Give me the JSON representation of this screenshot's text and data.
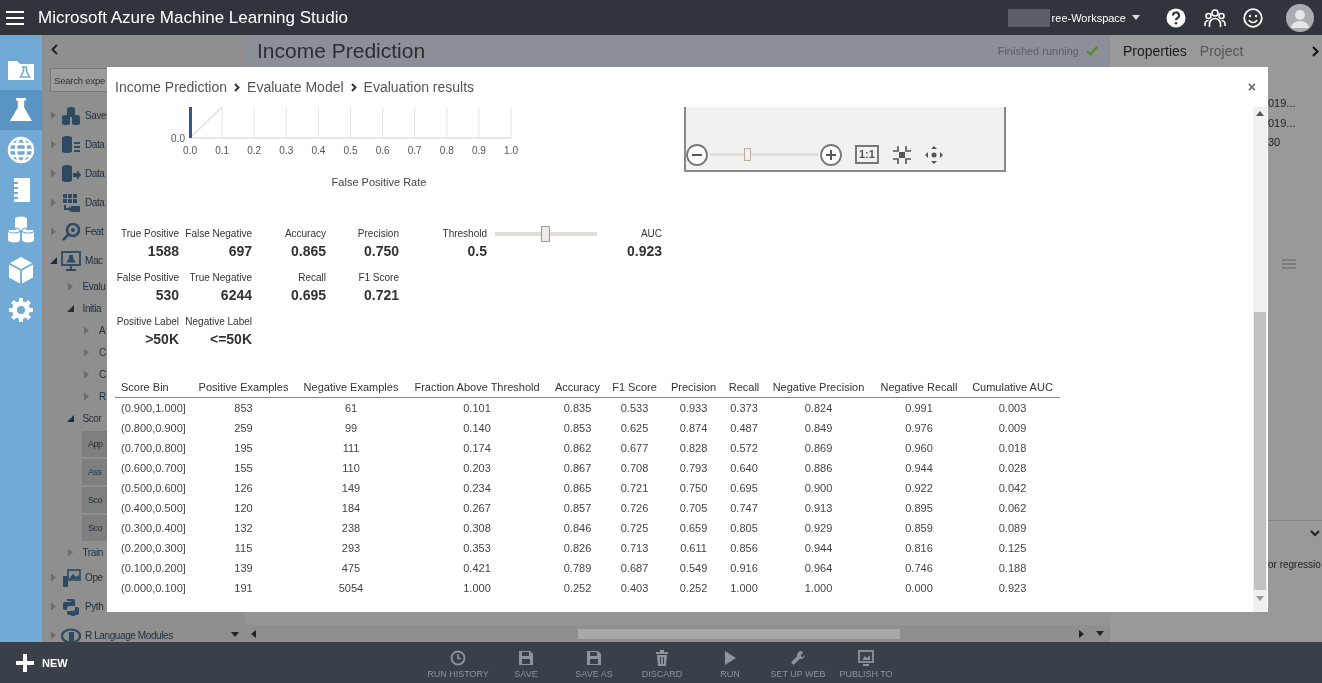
{
  "top_bar": {
    "title": "Microsoft Azure Machine Learning Studio",
    "workspace": "ree-Workspace"
  },
  "nav_rail": [
    {
      "kind": "experiments-folder",
      "selected": false
    },
    {
      "kind": "experiments",
      "selected": true
    },
    {
      "kind": "web-services",
      "selected": false
    },
    {
      "kind": "notebooks",
      "selected": false
    },
    {
      "kind": "datasets",
      "selected": false
    },
    {
      "kind": "trained-models",
      "selected": false
    },
    {
      "kind": "settings",
      "selected": false
    }
  ],
  "palette": {
    "search": {
      "placeholder": "Search expe"
    },
    "items": [
      {
        "label": "Save",
        "kind": "datasets",
        "expanded": false
      },
      {
        "label": "Data",
        "kind": "data-format",
        "expanded": false
      },
      {
        "label": "Data",
        "kind": "data-io",
        "expanded": false
      },
      {
        "label": "Data",
        "kind": "data-transform",
        "expanded": false
      },
      {
        "label": "Feat",
        "kind": "feature-selection",
        "expanded": false
      },
      {
        "label": "Mac",
        "kind": "ml",
        "expanded": true,
        "children": [
          {
            "label": "Evalu",
            "expanded": false
          },
          {
            "label": "Initia",
            "expanded": true,
            "children": [
              {
                "label": "A",
                "expanded": false
              },
              {
                "label": "C",
                "expanded": false
              },
              {
                "label": "C",
                "expanded": false
              },
              {
                "label": "R",
                "expanded": false
              }
            ]
          },
          {
            "label": "Scor",
            "expanded": true,
            "children": [
              {
                "label": "App",
                "kind": "module"
              },
              {
                "label": "Ass",
                "kind": "module"
              },
              {
                "label": "Sco",
                "kind": "module"
              },
              {
                "label": "Sco",
                "kind": "module"
              }
            ]
          },
          {
            "label": "Train",
            "expanded": false
          }
        ]
      },
      {
        "label": "Ope",
        "kind": "opencv",
        "expanded": false
      },
      {
        "label": "Pyth",
        "kind": "python",
        "expanded": false
      },
      {
        "label": "R Language Modules",
        "kind": "r",
        "expanded": false
      }
    ]
  },
  "canvas": {
    "title": "Income Prediction",
    "status": "Finished running"
  },
  "properties_panel": {
    "tabs": [
      {
        "label": "Properties",
        "selected": true
      },
      {
        "label": "Project",
        "selected": false
      }
    ],
    "values": [
      "019...",
      "019...",
      "30"
    ],
    "description": "or regressio"
  },
  "bottom_bar": {
    "new_label": "NEW",
    "actions": [
      {
        "kind": "history",
        "label": "RUN HISTORY"
      },
      {
        "kind": "save",
        "label": "SAVE"
      },
      {
        "kind": "save-as",
        "label": "SAVE AS"
      },
      {
        "kind": "discard",
        "label": "DISCARD"
      },
      {
        "kind": "run",
        "label": "RUN"
      },
      {
        "kind": "web-service",
        "label": "SET UP WEB"
      },
      {
        "kind": "publish",
        "label": "PUBLISH TO"
      }
    ]
  },
  "dialog": {
    "breadcrumb": [
      "Income Prediction",
      "Evaluate Model",
      "Evaluation results"
    ],
    "close": "×",
    "roc_chart": {
      "y_tick_labels": [
        "0.0"
      ],
      "x_tick_labels": [
        "0.0",
        "0.1",
        "0.2",
        "0.3",
        "0.4",
        "0.5",
        "0.6",
        "0.7",
        "0.8",
        "0.9",
        "1.0"
      ],
      "xlabel": "False Positive Rate"
    },
    "zoom_controls": {
      "level": 0.35,
      "actual_size": "1:1"
    },
    "metrics": {
      "rows": [
        [
          {
            "label": "True Positive",
            "value": "1588"
          },
          {
            "label": "False Negative",
            "value": "697"
          },
          {
            "label": "Accuracy",
            "value": "0.865"
          },
          {
            "label": "Precision",
            "value": "0.750"
          }
        ],
        [
          {
            "label": "False Positive",
            "value": "530"
          },
          {
            "label": "True Negative",
            "value": "6244"
          },
          {
            "label": "Recall",
            "value": "0.695"
          },
          {
            "label": "F1 Score",
            "value": "0.721"
          }
        ],
        [
          {
            "label": "Positive Label",
            "value": ">50K"
          },
          {
            "label": "Negative Label",
            "value": "<=50K"
          }
        ]
      ],
      "threshold": {
        "label": "Threshold",
        "value": "0.5",
        "level": 0.5
      },
      "auc": {
        "label": "AUC",
        "value": "0.923"
      }
    },
    "table": {
      "columns": [
        "Score Bin",
        "Positive Examples",
        "Negative Examples",
        "Fraction Above Threshold",
        "Accuracy",
        "F1 Score",
        "Precision",
        "Recall",
        "Negative Precision",
        "Negative Recall",
        "Cumulative AUC"
      ],
      "rows": [
        [
          "(0.900,1.000]",
          "853",
          "61",
          "0.101",
          "0.835",
          "0.533",
          "0.933",
          "0.373",
          "0.824",
          "0.991",
          "0.003"
        ],
        [
          "(0.800,0.900]",
          "259",
          "99",
          "0.140",
          "0.853",
          "0.625",
          "0.874",
          "0.487",
          "0.849",
          "0.976",
          "0.009"
        ],
        [
          "(0.700,0.800]",
          "195",
          "111",
          "0.174",
          "0.862",
          "0.677",
          "0.828",
          "0.572",
          "0.869",
          "0.960",
          "0.018"
        ],
        [
          "(0.600,0.700]",
          "155",
          "110",
          "0.203",
          "0.867",
          "0.708",
          "0.793",
          "0.640",
          "0.886",
          "0.944",
          "0.028"
        ],
        [
          "(0.500,0.600]",
          "126",
          "149",
          "0.234",
          "0.865",
          "0.721",
          "0.750",
          "0.695",
          "0.900",
          "0.922",
          "0.042"
        ],
        [
          "(0.400,0.500]",
          "120",
          "184",
          "0.267",
          "0.857",
          "0.726",
          "0.705",
          "0.747",
          "0.913",
          "0.895",
          "0.062"
        ],
        [
          "(0.300,0.400]",
          "132",
          "238",
          "0.308",
          "0.846",
          "0.725",
          "0.659",
          "0.805",
          "0.929",
          "0.859",
          "0.089"
        ],
        [
          "(0.200,0.300]",
          "115",
          "293",
          "0.353",
          "0.826",
          "0.713",
          "0.611",
          "0.856",
          "0.944",
          "0.816",
          "0.125"
        ],
        [
          "(0.100,0.200]",
          "139",
          "475",
          "0.421",
          "0.789",
          "0.687",
          "0.549",
          "0.916",
          "0.964",
          "0.746",
          "0.188"
        ],
        [
          "(0.000,0.100]",
          "191",
          "5054",
          "1.000",
          "0.252",
          "0.403",
          "0.252",
          "1.000",
          "1.000",
          "0.000",
          "0.923"
        ]
      ]
    }
  }
}
